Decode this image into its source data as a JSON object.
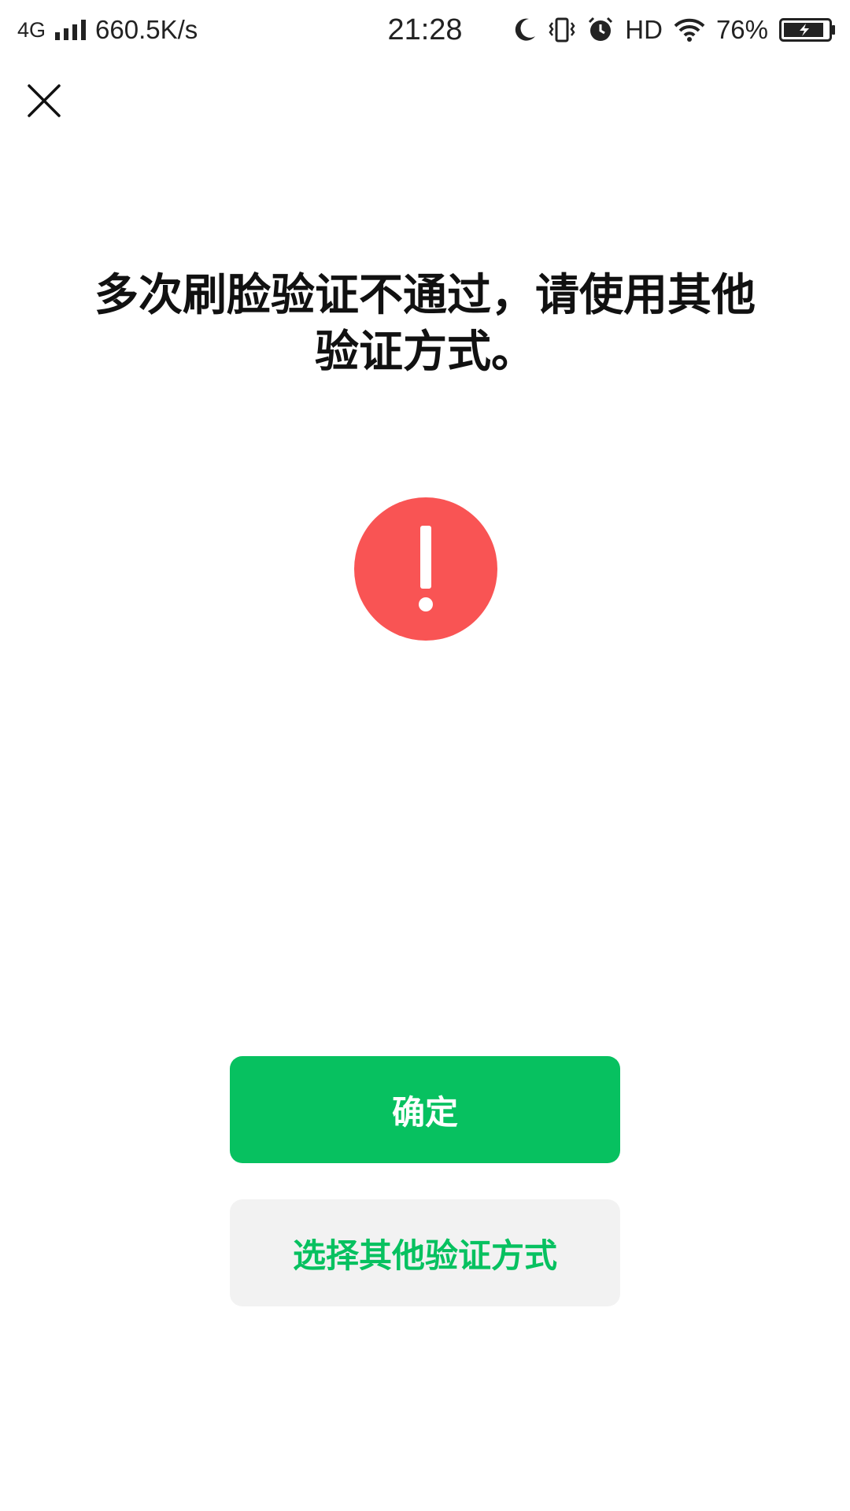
{
  "status_bar": {
    "network": "4G",
    "speed": "660.5K/s",
    "time": "21:28",
    "hd": "HD",
    "battery": "76%"
  },
  "icons": {
    "close": "close-icon",
    "error": "exclamation-circle-icon",
    "moon": "moon-icon",
    "vibrate": "vibrate-icon",
    "alarm": "alarm-icon",
    "wifi": "wifi-icon",
    "battery": "battery-charging-icon",
    "signal": "signal-icon"
  },
  "colors": {
    "accent": "#07C160",
    "error": "#F95454",
    "secondary_bg": "#F2F2F2"
  },
  "main": {
    "title": "多次刷脸验证不通过，请使用其他验证方式。",
    "confirm_label": "确定",
    "other_method_label": "选择其他验证方式"
  }
}
